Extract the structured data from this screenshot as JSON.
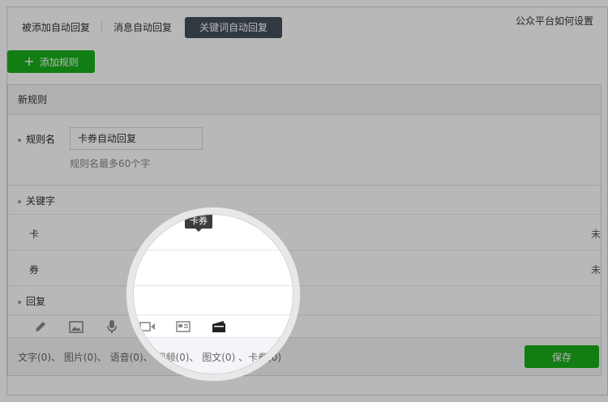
{
  "tabs": [
    {
      "label": "被添加自动回复"
    },
    {
      "label": "消息自动回复"
    },
    {
      "label": "关键词自动回复"
    }
  ],
  "help_link": "公众平台如何设置",
  "add_rule_label": "添加规则",
  "panel": {
    "title": "新规则",
    "rule_name_label": "规则名",
    "rule_name_value": "卡券自动回复",
    "rule_name_hint": "规则名最多60个字",
    "keyword_label": "关键字",
    "keywords": [
      "卡",
      "券"
    ],
    "reply_label": "回复",
    "tooltip": "卡券",
    "stats": "文字(0)、 图片(0)、 语音(0)、 视频(0)、 图文(0) 、卡券(0)",
    "save_label": "保存"
  },
  "colors": {
    "green": "#1aad19",
    "active_tab": "#44505d"
  },
  "icons": [
    "pencil-icon",
    "image-icon",
    "microphone-icon",
    "video-icon",
    "news-icon",
    "card-coupon-icon"
  ]
}
